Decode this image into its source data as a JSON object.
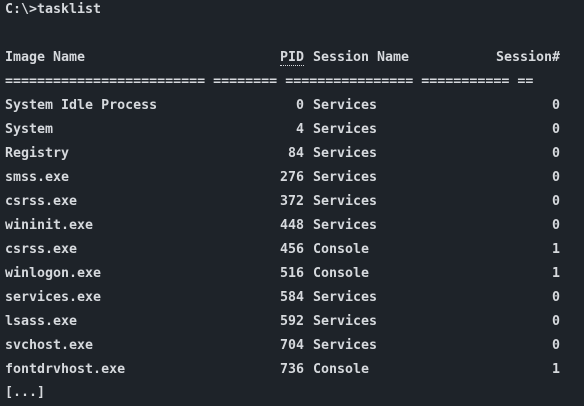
{
  "prompt": "C:\\>tasklist",
  "columns": {
    "image_name": "Image Name",
    "pid": "PID",
    "session_name": "Session Name",
    "session_num": "Session#"
  },
  "separator": "========================= ======== ================ =========== ==",
  "rows": [
    {
      "name": "System Idle Process",
      "pid": "0",
      "session": "Services",
      "num": "0"
    },
    {
      "name": "System",
      "pid": "4",
      "session": "Services",
      "num": "0"
    },
    {
      "name": "Registry",
      "pid": "84",
      "session": "Services",
      "num": "0"
    },
    {
      "name": "smss.exe",
      "pid": "276",
      "session": "Services",
      "num": "0"
    },
    {
      "name": "csrss.exe",
      "pid": "372",
      "session": "Services",
      "num": "0"
    },
    {
      "name": "wininit.exe",
      "pid": "448",
      "session": "Services",
      "num": "0"
    },
    {
      "name": "csrss.exe",
      "pid": "456",
      "session": "Console",
      "num": "1"
    },
    {
      "name": "winlogon.exe",
      "pid": "516",
      "session": "Console",
      "num": "1"
    },
    {
      "name": "services.exe",
      "pid": "584",
      "session": "Services",
      "num": "0"
    },
    {
      "name": "lsass.exe",
      "pid": "592",
      "session": "Services",
      "num": "0"
    },
    {
      "name": "svchost.exe",
      "pid": "704",
      "session": "Services",
      "num": "0"
    },
    {
      "name": "fontdrvhost.exe",
      "pid": "736",
      "session": "Console",
      "num": "1"
    }
  ],
  "more": "[...]",
  "colors": {
    "background": "#1e2329",
    "text": "#d6d9dd"
  }
}
